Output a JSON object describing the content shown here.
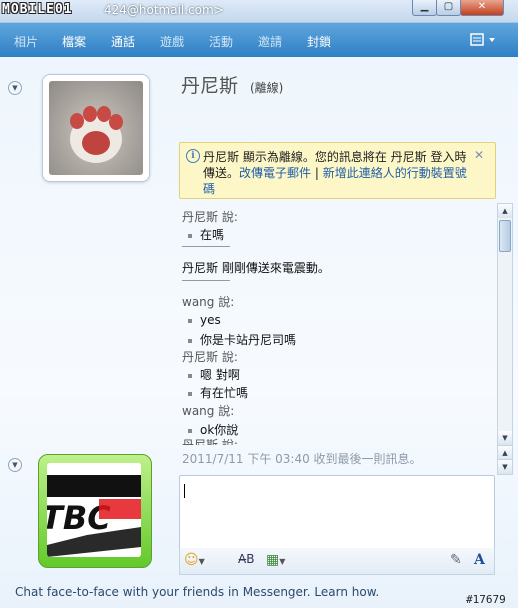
{
  "window": {
    "logo": "MOBILE01",
    "title": "424@hotmail.com>",
    "min_icon": "minimize-icon",
    "max_icon": "maximize-icon",
    "close_icon": "close-icon"
  },
  "nav": {
    "items": [
      "相片",
      "檔案",
      "通話",
      "遊戲",
      "活動",
      "邀請",
      "封鎖"
    ],
    "menu_icon": "menu-icon"
  },
  "contact": {
    "name": "丹尼斯",
    "status": "(離線)"
  },
  "notice": {
    "line1": "丹尼斯 顯示為離線。您的訊息將在 丹尼斯 登入時",
    "line2_prefix": "傳送。",
    "link1": "改傳電子郵件",
    "divider": "|",
    "link2_a": "新增此連絡人的行動裝置號",
    "link2_b": "碼"
  },
  "conversation": {
    "m1_sender": "丹尼斯 說:",
    "m1_text": "在嗎",
    "system_msg": "丹尼斯 剛剛傳送來電震動。",
    "m2_sender": "wang 說:",
    "m2_text1": "yes",
    "m2_text2": "你是卡站丹尼司嗎",
    "m3_sender": "丹尼斯 說:",
    "m3_text1": "嗯 對啊",
    "m3_text2": "有在忙嗎",
    "m4_sender": "wang 說:",
    "m4_text1": "ok你說",
    "m5_sender": "丹尼斯 說:"
  },
  "timestamp": "2011/7/11 下午 03:40 收到最後一則訊息。",
  "my_avatar_text": "TBC",
  "input": {
    "value": ""
  },
  "promo": "Chat face-to-face with your friends in Messenger. Learn how.",
  "watermark": "#17679",
  "colors": {
    "nav_bg": "#2f7fc4",
    "notice_bg": "#fdf7c7",
    "link": "#1f5ea8",
    "avatar_frame": "#63c92b"
  }
}
